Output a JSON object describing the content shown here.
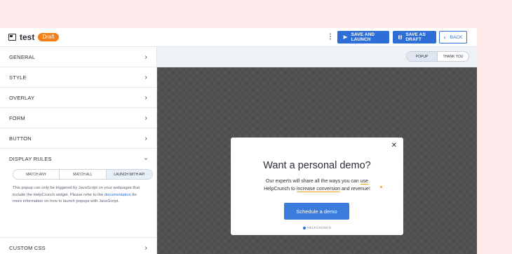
{
  "header": {
    "title": "test",
    "status_badge": "Draft",
    "more_icon": "kebab-vertical-icon",
    "save_launch_label": "SAVE AND LAUNCH",
    "save_draft_label": "SAVE AS DRAFT",
    "back_label": "BACK"
  },
  "sidebar": {
    "items": [
      {
        "label": "GENERAL"
      },
      {
        "label": "STYLE"
      },
      {
        "label": "OVERLAY"
      },
      {
        "label": "FORM"
      },
      {
        "label": "BUTTON"
      },
      {
        "label": "DISPLAY RULES"
      },
      {
        "label": "CUSTOM CSS"
      }
    ],
    "display_rules": {
      "options": [
        "MATCH ANY",
        "MATCH ALL",
        "LAUNCH WITH API"
      ],
      "selected": "LAUNCH WITH API",
      "text_before": "This popup can only be triggered by JavaScript on your webpages that include the HelpCrunch widget. Please refer to the ",
      "link": "documentation",
      "text_after": " for more information on how to launch popups with JavaScript."
    }
  },
  "preview": {
    "tabs": [
      "POPUP",
      "THANK YOU"
    ],
    "active_tab": "POPUP",
    "popup": {
      "heading": "Want a personal demo?",
      "sub_before": "Our experts will share all the ways you can ",
      "sub_hl1": "use",
      "sub_mid": " HelpCrunch to ",
      "sub_hl2": "increase conversion",
      "sub_after": " and revenue!",
      "cta": "Schedule a demo",
      "brand": "HELPCRUNCH"
    }
  },
  "colors": {
    "accent": "#2d6fd6",
    "badge": "#f57f17",
    "page_bg": "#fdeaea"
  }
}
